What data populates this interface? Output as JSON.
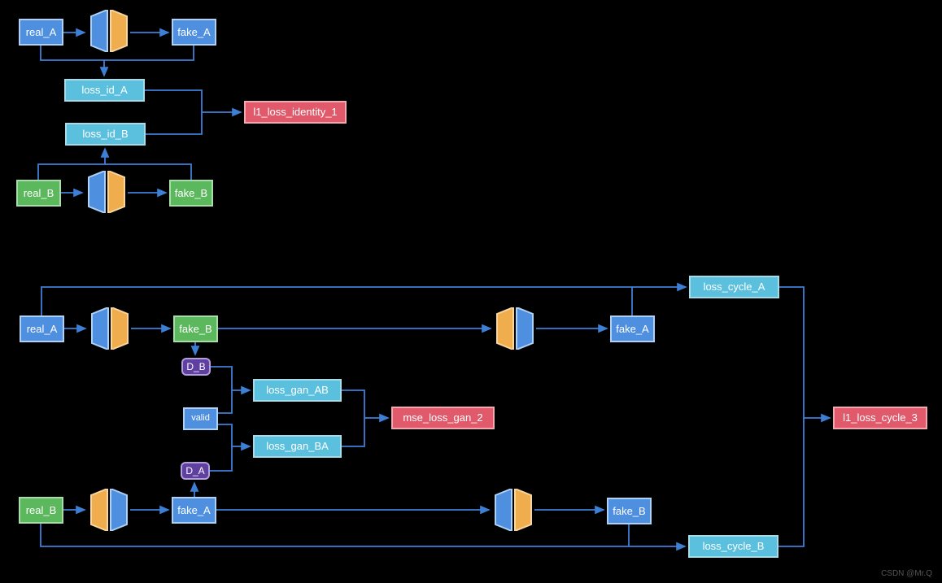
{
  "section1": {
    "real_A": "real_A",
    "fake_A": "fake_A",
    "loss_id_A": "loss_id_A",
    "loss_id_B": "loss_id_B",
    "real_B": "real_B",
    "fake_B": "fake_B",
    "l1_loss_identity": "l1_loss_identity_1"
  },
  "section2": {
    "real_A": "real_A",
    "fake_B": "fake_B",
    "fake_A_right": "fake_A",
    "D_B": "D_B",
    "valid": "valid",
    "D_A": "D_A",
    "loss_gan_AB": "loss_gan_AB",
    "loss_gan_BA": "loss_gan_BA",
    "mse_loss_gan": "mse_loss_gan_2",
    "real_B": "real_B",
    "fake_A": "fake_A",
    "fake_B_right": "fake_B",
    "loss_cycle_A": "loss_cycle_A",
    "loss_cycle_B": "loss_cycle_B",
    "l1_loss_cycle": "l1_loss_cycle_3"
  },
  "watermark": "CSDN @Mr.Q"
}
